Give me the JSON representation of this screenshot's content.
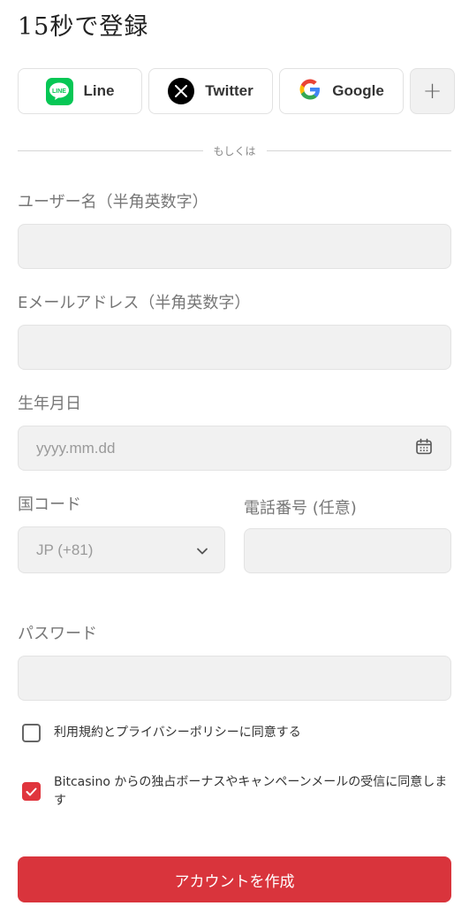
{
  "page": {
    "title": "15秒で登録"
  },
  "social": {
    "line_label": "Line",
    "twitter_label": "Twitter",
    "google_label": "Google",
    "more_label": "+"
  },
  "divider_text": "もしくは",
  "form": {
    "username": {
      "label": "ユーザー名（半角英数字）",
      "value": ""
    },
    "email": {
      "label": "Eメールアドレス（半角英数字）",
      "value": ""
    },
    "birthdate": {
      "label": "生年月日",
      "placeholder": "yyyy.mm.dd"
    },
    "country_code": {
      "label": "国コード",
      "value": "JP (+81)"
    },
    "phone": {
      "label": "電話番号 (任意)",
      "value": ""
    },
    "password": {
      "label": "パスワード",
      "value": ""
    }
  },
  "checkboxes": {
    "terms": {
      "label": "利用規約とプライバシーポリシーに同意する",
      "checked": false
    },
    "marketing": {
      "label": "Bitcasino からの独占ボーナスやキャンペーンメールの受信に同意します",
      "checked": true
    }
  },
  "submit_label": "アカウントを作成",
  "colors": {
    "accent": "#d9343c",
    "line_green": "#06c755",
    "field_bg": "#f1f1f1"
  },
  "icons": [
    "line-logo-icon",
    "x-logo-icon",
    "google-logo-icon",
    "plus-icon",
    "calendar-icon",
    "chevron-down-icon",
    "checkmark-icon"
  ]
}
